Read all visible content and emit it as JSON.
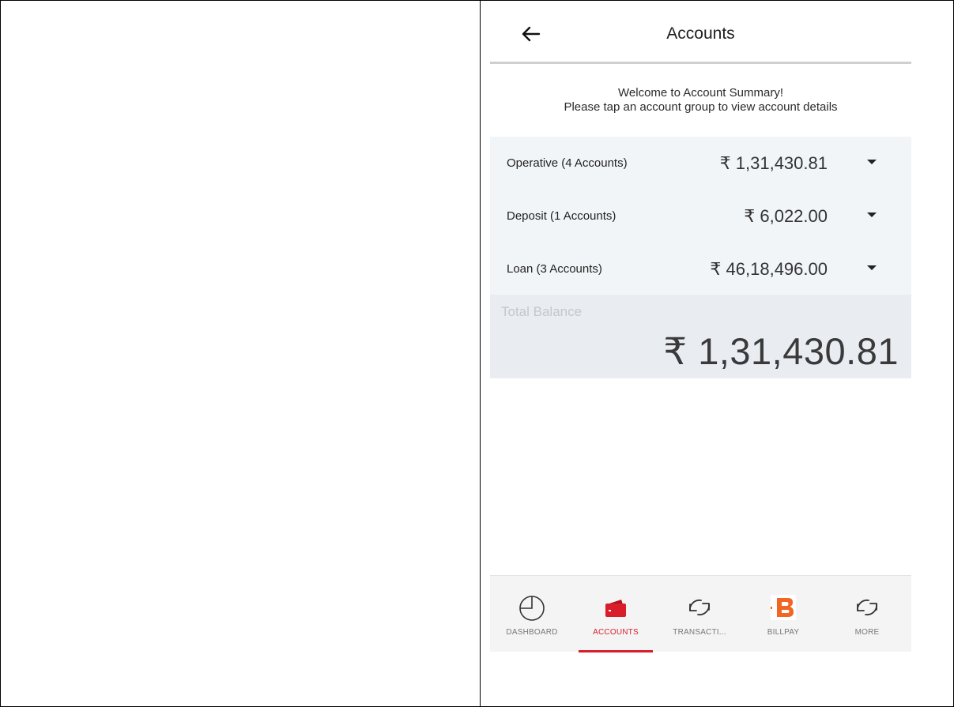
{
  "header": {
    "title": "Accounts",
    "back_icon": "arrow-left-icon"
  },
  "welcome": {
    "line1": "Welcome to Account Summary!",
    "line2": "Please tap an account group to view account details"
  },
  "groups": [
    {
      "label": "Operative (4 Accounts)",
      "amount": "₹ 1,31,430.81"
    },
    {
      "label": "Deposit (1 Accounts)",
      "amount": "₹ 6,022.00"
    },
    {
      "label": "Loan (3 Accounts)",
      "amount": "₹ 46,18,496.00"
    }
  ],
  "total": {
    "label": "Total Balance",
    "amount": "₹ 1,31,430.81"
  },
  "nav": [
    {
      "label": "DASHBOARD",
      "icon": "pie-chart-icon",
      "active": false
    },
    {
      "label": "ACCOUNTS",
      "icon": "wallet-icon",
      "active": true
    },
    {
      "label": "TRANSACTI...",
      "icon": "refresh-arrows-icon",
      "active": false
    },
    {
      "label": "BILLPAY",
      "icon": "billpay-logo-icon",
      "active": false
    },
    {
      "label": "MORE",
      "icon": "refresh-arrows-icon",
      "active": false
    }
  ],
  "colors": {
    "accent": "#d81e2a",
    "group_bg": "#f2f5f8",
    "total_bg": "#e9edf1",
    "billpay_orange": "#f26522"
  }
}
